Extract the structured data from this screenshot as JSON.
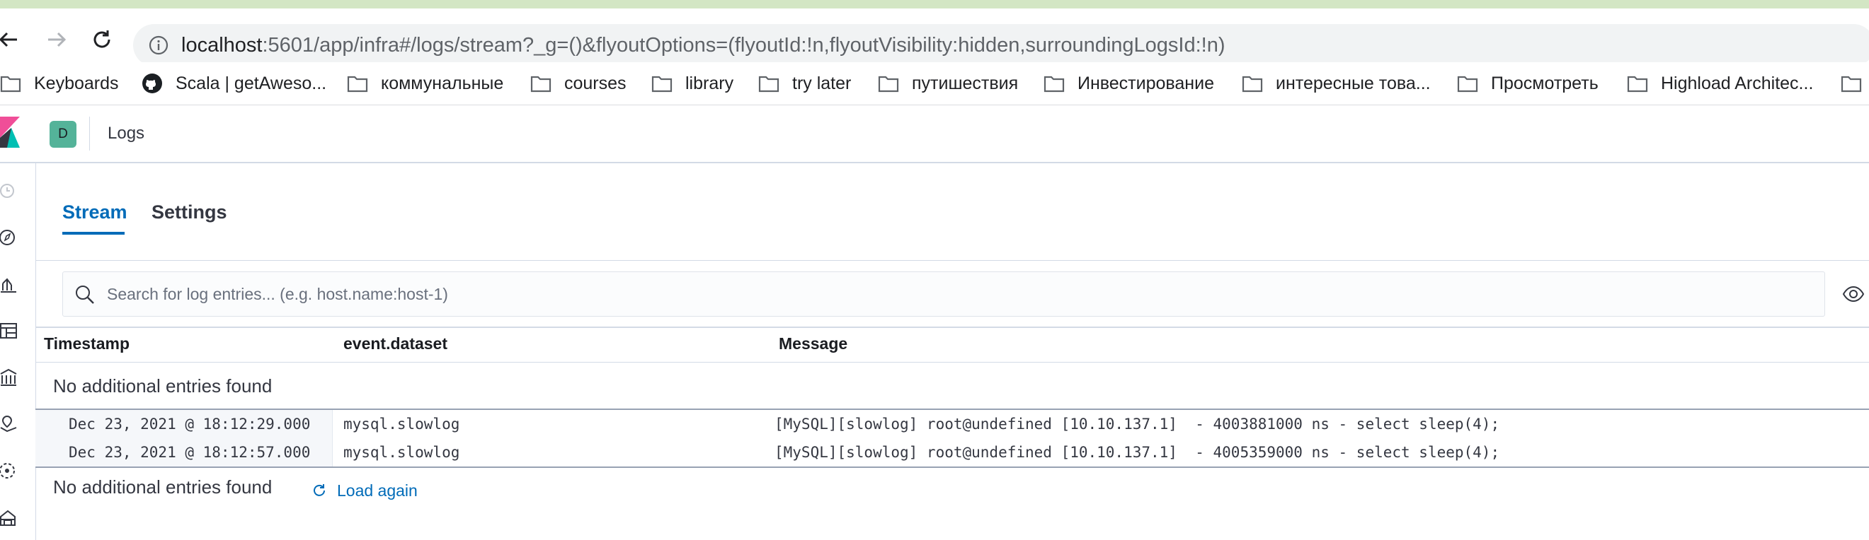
{
  "browser": {
    "url_host": "localhost",
    "url_rest": ":5601/app/infra#/logs/stream?_g=()&flyoutOptions=(flyoutId:!n,flyoutVisibility:hidden,surroundingLogsId:!n)",
    "bookmarks": [
      {
        "label": "Keyboards",
        "icon": "folder-icon"
      },
      {
        "label": "Scala | getAweso...",
        "icon": "github-icon"
      },
      {
        "label": "коммунальные",
        "icon": "folder-icon"
      },
      {
        "label": "courses",
        "icon": "folder-icon"
      },
      {
        "label": "library",
        "icon": "folder-icon"
      },
      {
        "label": "try later",
        "icon": "folder-icon"
      },
      {
        "label": "путишествия",
        "icon": "folder-icon"
      },
      {
        "label": "Инвестирование",
        "icon": "folder-icon"
      },
      {
        "label": "интересные това...",
        "icon": "folder-icon"
      },
      {
        "label": "Просмотреть",
        "icon": "folder-icon"
      },
      {
        "label": "Highload Architec...",
        "icon": "folder-icon"
      }
    ]
  },
  "header": {
    "avatar_letter": "D",
    "breadcrumb": "Logs"
  },
  "tabs": [
    {
      "label": "Stream",
      "active": true
    },
    {
      "label": "Settings",
      "active": false
    }
  ],
  "search": {
    "placeholder": "Search for log entries... (e.g. host.name:host-1)"
  },
  "columns": {
    "timestamp": "Timestamp",
    "dataset": "event.dataset",
    "message": "Message"
  },
  "notices": {
    "top": "No additional entries found",
    "bottom": "No additional entries found",
    "load_again": "Load again"
  },
  "rows": [
    {
      "timestamp": "Dec 23, 2021 @ 18:12:29.000",
      "dataset": "mysql.slowlog",
      "message": "[MySQL][slowlog] root@undefined [10.10.137.1]  - 4003881000 ns - select sleep(4);"
    },
    {
      "timestamp": "Dec 23, 2021 @ 18:12:57.000",
      "dataset": "mysql.slowlog",
      "message": "[MySQL][slowlog] root@undefined [10.10.137.1]  - 4005359000 ns - select sleep(4);"
    }
  ],
  "colors": {
    "accent": "#006bb8",
    "avatar": "#54b399",
    "logo_pink": "#f04e98",
    "logo_teal": "#00bfb3"
  }
}
